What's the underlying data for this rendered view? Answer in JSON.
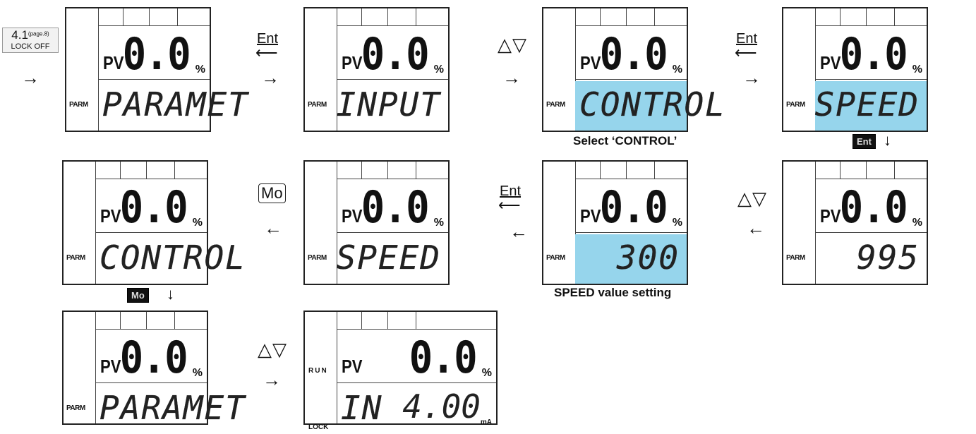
{
  "start_ref": {
    "num": "4.1",
    "page": "(page.8)",
    "lock": "LOCK OFF"
  },
  "captions": {
    "select_control": "Select ‘CONTROL’",
    "speed_setting": "SPEED value setting"
  },
  "keys": {
    "ent": "Ent",
    "updown": "△▽",
    "mo": "Mo",
    "mo_dark": "Mo",
    "ent_dark": "Ent"
  },
  "arrows": {
    "right": "→",
    "left": "←",
    "down": "↓",
    "ent": "⟵"
  },
  "display": {
    "pv": "PV",
    "value": "0.0",
    "pct": "%",
    "parm": "PARM",
    "run": "RUN",
    "lock": "LOCK",
    "ma": "mA"
  },
  "screens": [
    {
      "text": "PARAMET",
      "align": "l",
      "hl": false
    },
    {
      "text": "INPUT",
      "align": "r",
      "hl": false
    },
    {
      "text": "CONTROL",
      "align": "l",
      "hl": true
    },
    {
      "text": "SPEED",
      "align": "r",
      "hl": true
    },
    {
      "text": "995",
      "align": "r",
      "hl": false
    },
    {
      "text": "300",
      "align": "r",
      "hl": true
    },
    {
      "text": "SPEED",
      "align": "r",
      "hl": false
    },
    {
      "text": "CONTROL",
      "align": "l",
      "hl": false
    },
    {
      "text": "PARAMET",
      "align": "l",
      "hl": false
    },
    {
      "text": "IN",
      "align": "l",
      "hl": false,
      "tail": "4.00"
    }
  ]
}
